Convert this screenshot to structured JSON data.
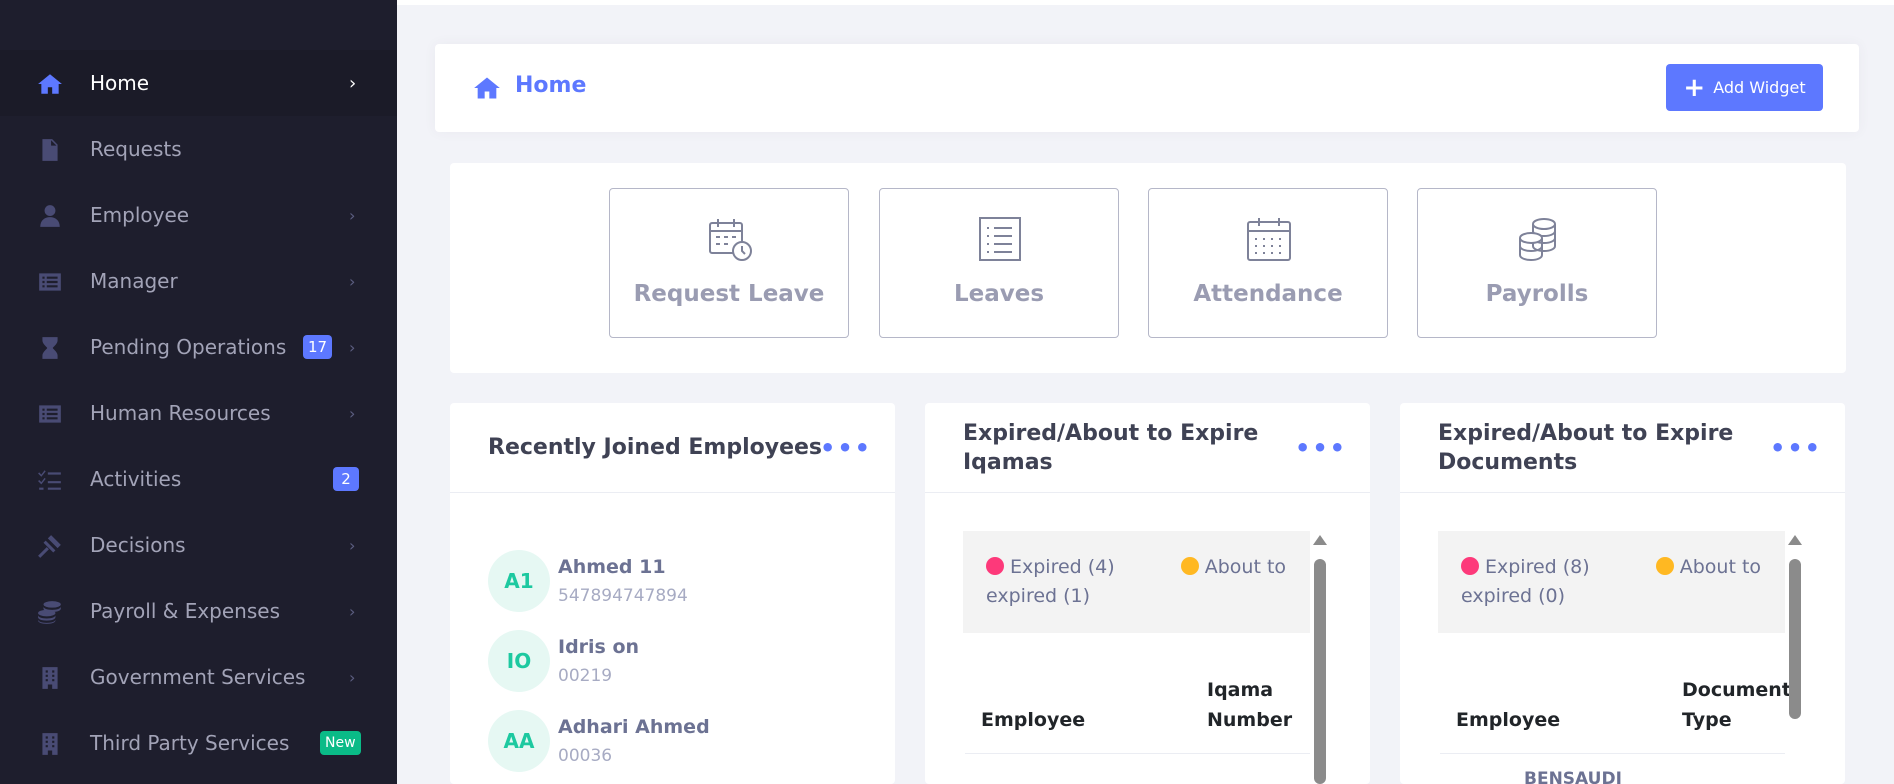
{
  "sidebar": {
    "items": [
      {
        "label": "Home",
        "icon": "home-icon",
        "active": true
      },
      {
        "label": "Requests",
        "icon": "document-icon"
      },
      {
        "label": "Employee",
        "icon": "user-icon"
      },
      {
        "label": "Manager",
        "icon": "list-icon"
      },
      {
        "label": "Pending Operations",
        "icon": "hourglass-icon",
        "badge": "17"
      },
      {
        "label": "Human Resources",
        "icon": "list-icon"
      },
      {
        "label": "Activities",
        "icon": "checklist-icon",
        "badge": "2"
      },
      {
        "label": "Decisions",
        "icon": "gavel-icon"
      },
      {
        "label": "Payroll & Expenses",
        "icon": "coins-icon"
      },
      {
        "label": "Government Services",
        "icon": "building-icon"
      },
      {
        "label": "Third Party Services",
        "icon": "building-icon",
        "badge": "New"
      }
    ],
    "chevron": "›"
  },
  "header": {
    "title": "Home",
    "add_widget_label": "Add Widget"
  },
  "quick_links": [
    {
      "label": "Request Leave",
      "icon": "calendar-clock-icon"
    },
    {
      "label": "Leaves",
      "icon": "list-icon"
    },
    {
      "label": "Attendance",
      "icon": "calendar-icon"
    },
    {
      "label": "Payrolls",
      "icon": "coins-icon"
    }
  ],
  "widgets": {
    "recent": {
      "title": "Recently Joined Employees",
      "menu": "•••",
      "employees": [
        {
          "initials": "A1",
          "name": "Ahmed 11",
          "id": "547894747894"
        },
        {
          "initials": "IO",
          "name": "Idris on",
          "id": "00219"
        },
        {
          "initials": "AA",
          "name": "Adhari Ahmed",
          "id": "00036"
        }
      ]
    },
    "iqamas": {
      "title_line1": "Expired/About to Expire",
      "title_line2": "Iqamas",
      "menu": "•••",
      "expired_label": "Expired (4)",
      "about_label": "About to",
      "about_label2": "expired (1)",
      "col1": "Employee",
      "col2_line1": "Iqama",
      "col2_line2": "Number"
    },
    "documents": {
      "title_line1": "Expired/About to Expire",
      "title_line2": "Documents",
      "menu": "•••",
      "expired_label": "Expired (8)",
      "about_label": "About to",
      "about_label2": "expired (0)",
      "col1": "Employee",
      "col2_line1": "Document",
      "col2_line2": "Type",
      "partial_row": "BENSAUDI"
    }
  },
  "colors": {
    "accent": "#5d78ff",
    "sidebar_bg": "#1e1e2d",
    "expired": "#fd397a",
    "about": "#ffb822",
    "new_badge": "#0abb87"
  }
}
